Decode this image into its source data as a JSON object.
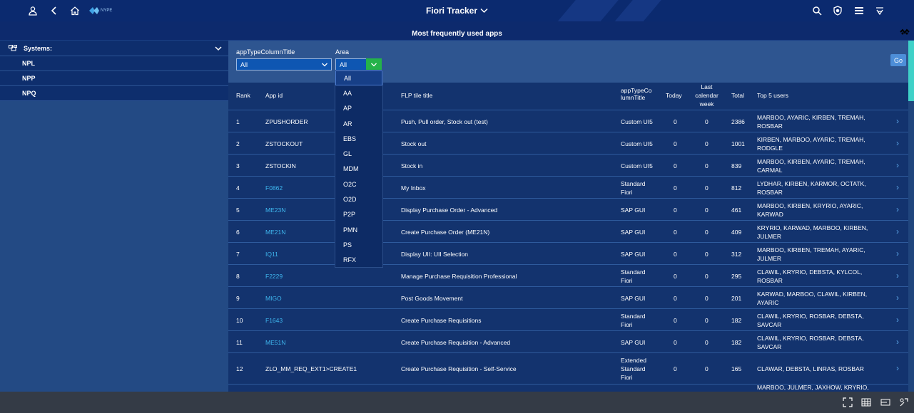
{
  "header": {
    "app_title": "Fiori Tracker",
    "logo_text": "NYPE",
    "icons": [
      "user-icon",
      "back-icon",
      "home-icon",
      "search-icon",
      "badge-icon",
      "menu-icon",
      "notification-icon"
    ]
  },
  "subheader": {
    "title": "Most frequently used apps"
  },
  "sidebar": {
    "section_label": "Systems:",
    "items": [
      {
        "label": "NPL"
      },
      {
        "label": "NPP"
      },
      {
        "label": "NPQ"
      }
    ]
  },
  "filters": {
    "apptype_label": "appTypeColumnTitle",
    "apptype_value": "All",
    "area_label": "Area",
    "area_value": "All",
    "go_label": "Go",
    "area_options": [
      "All",
      "AA",
      "AP",
      "AR",
      "EBS",
      "GL",
      "MDM",
      "O2C",
      "O2D",
      "P2P",
      "PMN",
      "PS",
      "RFX"
    ]
  },
  "table": {
    "headers": {
      "rank": "Rank",
      "app_id": "App id",
      "flp_title": "FLP tile title",
      "apptype_line1": "appTypeCo",
      "apptype_line2": "lumnTitle",
      "today": "Today",
      "lastweek_line1": "Last",
      "lastweek_line2": "calendar",
      "lastweek_line3": "week",
      "total": "Total",
      "top5": "Top 5 users"
    },
    "rows": [
      {
        "rank": "1",
        "app_id": "ZPUSHORDER",
        "link": false,
        "title": "Push, Pull order, Stock out (test)",
        "type1": "Custom UI5",
        "type2": "",
        "today": "0",
        "week": "0",
        "total": "2386",
        "users1": "MARBOO, AYARIC, KIRBEN, TREMAH,",
        "users2": "ROSBAR"
      },
      {
        "rank": "2",
        "app_id": "ZSTOCKOUT",
        "link": false,
        "title": "Stock out",
        "type1": "Custom UI5",
        "type2": "",
        "today": "0",
        "week": "0",
        "total": "1001",
        "users1": "KIRBEN, MARBOO, AYARIC, TREMAH,",
        "users2": "RODGLE"
      },
      {
        "rank": "3",
        "app_id": "ZSTOCKIN",
        "link": false,
        "title": "Stock in",
        "type1": "Custom UI5",
        "type2": "",
        "today": "0",
        "week": "0",
        "total": "839",
        "users1": "MARBOO, KIRBEN, AYARIC, TREMAH,",
        "users2": "CARMAL"
      },
      {
        "rank": "4",
        "app_id": "F0862",
        "link": true,
        "title": "My Inbox",
        "type1": "Standard",
        "type2": "Fiori",
        "today": "0",
        "week": "0",
        "total": "812",
        "users1": "LYDHAR, KIRBEN, KARMOR, OCTATK,",
        "users2": "ROSBAR"
      },
      {
        "rank": "5",
        "app_id": "ME23N",
        "link": true,
        "title": "Display Purchase Order - Advanced",
        "type1": "SAP GUI",
        "type2": "",
        "today": "0",
        "week": "0",
        "total": "461",
        "users1": "MARBOO, KIRBEN, KRYRIO, AYARIC,",
        "users2": "KARWAD"
      },
      {
        "rank": "6",
        "app_id": "ME21N",
        "link": true,
        "title": "Create Purchase Order (ME21N)",
        "type1": "SAP GUI",
        "type2": "",
        "today": "0",
        "week": "0",
        "total": "409",
        "users1": "KRYRIO, KARWAD, MARBOO, KIRBEN,",
        "users2": "JULMER"
      },
      {
        "rank": "7",
        "app_id": "IQ11",
        "link": true,
        "title": "Display UII: UII Selection",
        "type1": "SAP GUI",
        "type2": "",
        "today": "0",
        "week": "0",
        "total": "312",
        "users1": "MARBOO, KIRBEN, TREMAH, AYARIC,",
        "users2": "JULMER"
      },
      {
        "rank": "8",
        "app_id": "F2229",
        "link": true,
        "title": "Manage Purchase Requisition Professional",
        "type1": "Standard",
        "type2": "Fiori",
        "today": "0",
        "week": "0",
        "total": "295",
        "users1": "CLAWIL, KRYRIO, DEBSTA, KYLCOL,",
        "users2": "ROSBAR"
      },
      {
        "rank": "9",
        "app_id": "MIGO",
        "link": true,
        "title": "Post Goods Movement",
        "type1": "SAP GUI",
        "type2": "",
        "today": "0",
        "week": "0",
        "total": "201",
        "users1": "KARWAD, MARBOO, CLAWIL, KIRBEN,",
        "users2": "AYARIC"
      },
      {
        "rank": "10",
        "app_id": "F1643",
        "link": true,
        "title": "Create Purchase Requisitions",
        "type1": "Standard",
        "type2": "Fiori",
        "today": "0",
        "week": "0",
        "total": "182",
        "users1": "CLAWIL, KRYRIO, ROSBAR, DEBSTA,",
        "users2": "SAVCAR"
      },
      {
        "rank": "11",
        "app_id": "ME51N",
        "link": true,
        "title": "Create Purchase Requisition - Advanced",
        "type1": "SAP GUI",
        "type2": "",
        "today": "0",
        "week": "0",
        "total": "182",
        "users1": "CLAWIL, KRYRIO, ROSBAR, DEBSTA,",
        "users2": "SAVCAR"
      },
      {
        "rank": "12",
        "app_id": "ZLO_MM_REQ_EXT1>CREATE1",
        "link": false,
        "title": "Create Purchase Requisition - Self-Service",
        "type1": "Extended",
        "type2": "Standard",
        "type3": "Fiori",
        "today": "0",
        "week": "0",
        "total": "165",
        "users1": "CLAWAR, DEBSTA, LINRAS, ROSBAR",
        "users2": ""
      },
      {
        "rank": "",
        "app_id": "",
        "link": false,
        "title": "",
        "type1": "",
        "type2": "",
        "today": "",
        "week": "",
        "total": "",
        "users1": "MARBOO, JULMER, JAXHOW, KRYRIO,",
        "users2": ""
      }
    ]
  },
  "footer": {
    "icons": [
      "fullscreen-icon",
      "grid-icon",
      "layout-icon",
      "settings-icon"
    ]
  },
  "colors": {
    "header": "#0b2a6f",
    "link": "#3fb7ef",
    "accent_green": "#24b24a",
    "scroll_thumb": "#3fd1c8"
  }
}
